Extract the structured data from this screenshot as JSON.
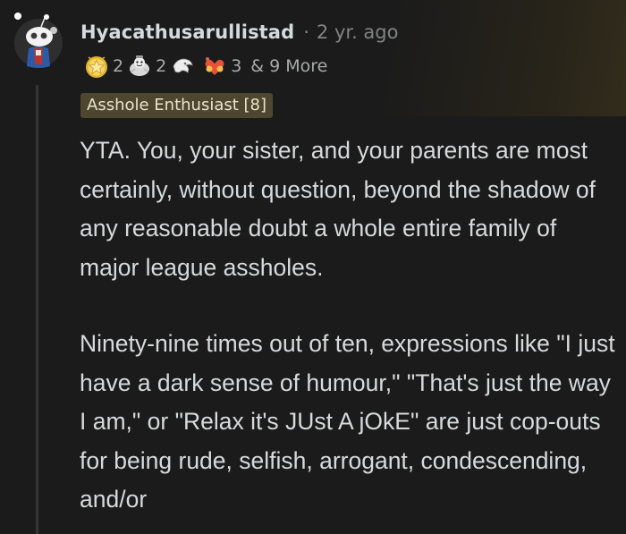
{
  "comment": {
    "username": "Hyacathusarullistad",
    "separator": "·",
    "timestamp": "2 yr. ago",
    "awards": [
      {
        "icon": "gold-star-award-icon",
        "count": "2"
      },
      {
        "icon": "wholesome-seal-award-icon",
        "count": "2"
      },
      {
        "icon": "hand-award-icon",
        "count": ""
      },
      {
        "icon": "heart-hands-award-icon",
        "count": "3"
      }
    ],
    "awards_more": "& 9 More",
    "flair": "Asshole Enthusiast [8]",
    "paragraphs": [
      "YTA. You, your sister, and your parents are most certainly, without question, beyond the shadow of any reasonable doubt a whole entire family of major league assholes.",
      "Ninety-nine times out of ten, expressions like \"I just have a dark sense of humour,\" \"That's just the way I am,\" or \"Relax it's JUst A jOkE\" are just cop-outs for being rude, selfish, arrogant, condescending, and/or"
    ]
  },
  "colors": {
    "background": "#1b1b1b",
    "text": "#d7dadc",
    "muted": "#818384",
    "flair_bg": "#4f4630",
    "thread_line": "#343434"
  }
}
